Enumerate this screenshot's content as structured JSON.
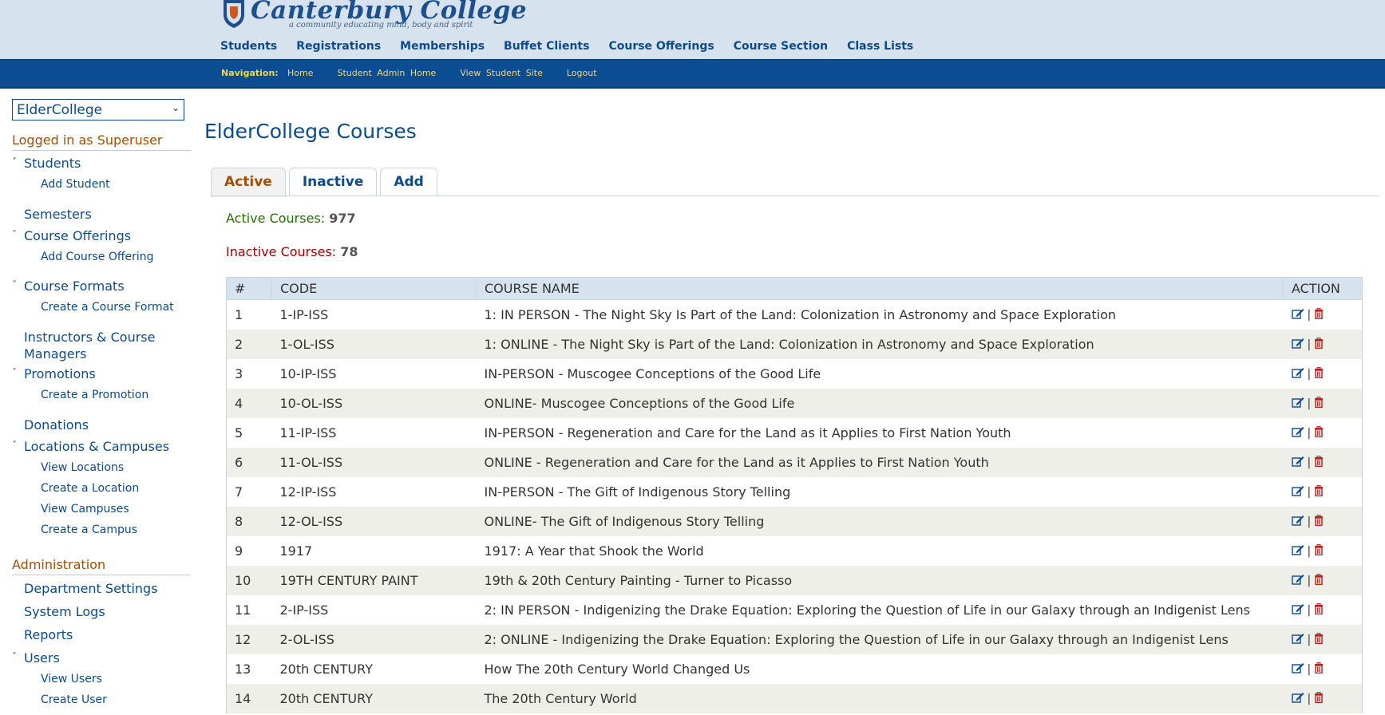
{
  "app": {
    "logo_title": "Canterbury College",
    "logo_tagline": "a community educating mind, body and spirit"
  },
  "topnav": [
    "Students",
    "Registrations",
    "Memberships",
    "Buffet Clients",
    "Course Offerings",
    "Course Section",
    "Class Lists"
  ],
  "navbar": {
    "label": "Navigation:",
    "links": [
      "Home",
      "Student Admin Home",
      "View Student Site",
      "Logout"
    ]
  },
  "sidebar": {
    "department": "ElderCollege",
    "logged_in": "Logged in as Superuser",
    "students": "Students",
    "add_student": "Add Student",
    "semesters": "Semesters",
    "course_offerings": "Course Offerings",
    "add_course_offering": "Add Course Offering",
    "course_formats": "Course Formats",
    "create_course_format": "Create a Course Format",
    "instructors": "Instructors & Course Managers",
    "promotions": "Promotions",
    "create_promotion": "Create a Promotion",
    "donations": "Donations",
    "locations": "Locations & Campuses",
    "view_locations": "View Locations",
    "create_location": "Create a Location",
    "view_campuses": "View Campuses",
    "create_campus": "Create a Campus",
    "administration": "Administration",
    "department_settings": "Department Settings",
    "system_logs": "System Logs",
    "reports": "Reports",
    "users": "Users",
    "view_users": "View Users",
    "create_user": "Create User"
  },
  "main": {
    "title": "ElderCollege Courses",
    "tabs": [
      "Active",
      "Inactive",
      "Add"
    ],
    "active_label": "Active Courses:",
    "active_count": "977",
    "inactive_label": "Inactive Courses:",
    "inactive_count": "78",
    "columns": [
      "#",
      "CODE",
      "COURSE NAME",
      "ACTION"
    ],
    "rows": [
      {
        "n": "1",
        "code": "1-IP-ISS",
        "name": "1: IN PERSON - The Night Sky Is Part of the Land: Colonization in Astronomy and Space Exploration"
      },
      {
        "n": "2",
        "code": "1-OL-ISS",
        "name": "1: ONLINE - The Night Sky is Part of the Land: Colonization in Astronomy and Space Exploration"
      },
      {
        "n": "3",
        "code": "10-IP-ISS",
        "name": "IN-PERSON - Muscogee Conceptions of the Good Life"
      },
      {
        "n": "4",
        "code": "10-OL-ISS",
        "name": "ONLINE- Muscogee Conceptions of the Good Life"
      },
      {
        "n": "5",
        "code": "11-IP-ISS",
        "name": "IN-PERSON - Regeneration and Care for the Land as it Applies to First Nation Youth"
      },
      {
        "n": "6",
        "code": "11-OL-ISS",
        "name": "ONLINE - Regeneration and Care for the Land as it Applies to First Nation Youth"
      },
      {
        "n": "7",
        "code": "12-IP-ISS",
        "name": "IN-PERSON - The Gift of Indigenous Story Telling"
      },
      {
        "n": "8",
        "code": "12-OL-ISS",
        "name": "ONLINE- The Gift of Indigenous Story Telling"
      },
      {
        "n": "9",
        "code": "1917",
        "name": "1917: A Year that Shook the World"
      },
      {
        "n": "10",
        "code": "19TH CENTURY PAINT",
        "name": "19th & 20th Century Painting - Turner to Picasso"
      },
      {
        "n": "11",
        "code": "2-IP-ISS",
        "name": "2: IN PERSON - Indigenizing the Drake Equation: Exploring the Question of Life in our Galaxy through an Indigenist Lens"
      },
      {
        "n": "12",
        "code": "2-OL-ISS",
        "name": "2: ONLINE - Indigenizing the Drake Equation: Exploring the Question of Life in our Galaxy through an Indigenist Lens"
      },
      {
        "n": "13",
        "code": "20th CENTURY",
        "name": "How The 20th Century World Changed Us"
      },
      {
        "n": "14",
        "code": "20th CENTURY",
        "name": "The 20th Century World"
      }
    ],
    "action_sep": "|"
  },
  "colors": {
    "brand_blue": "#0b4d93",
    "header_bg": "#d6e3ef",
    "accent_orange": "#a54e00",
    "active_green": "#237000",
    "inactive_red": "#a00000",
    "nav_yellow": "#f5d84a"
  },
  "icons": [
    "crest-icon",
    "chevron-down-icon",
    "edit-icon",
    "trash-icon"
  ]
}
